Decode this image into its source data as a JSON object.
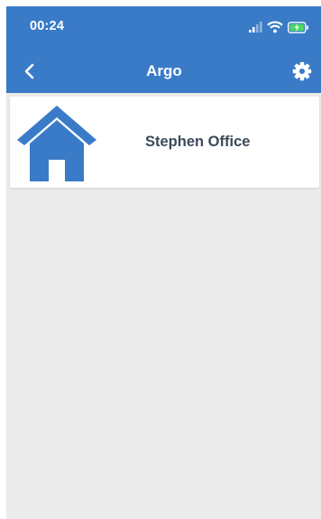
{
  "status_bar": {
    "time": "00:24",
    "icons": [
      "signal-icon",
      "wifi-icon",
      "battery-charging-icon"
    ]
  },
  "navbar": {
    "title": "Argo",
    "back_icon": "chevron-left-icon",
    "settings_icon": "gear-icon"
  },
  "locations": [
    {
      "name": "Stephen Office",
      "icon": "home-icon"
    }
  ],
  "colors": {
    "header": "#3a7bc8",
    "background": "#ebebeb",
    "card": "#ffffff",
    "card_text": "#3c4a5a",
    "icon": "#3a7bc8"
  }
}
